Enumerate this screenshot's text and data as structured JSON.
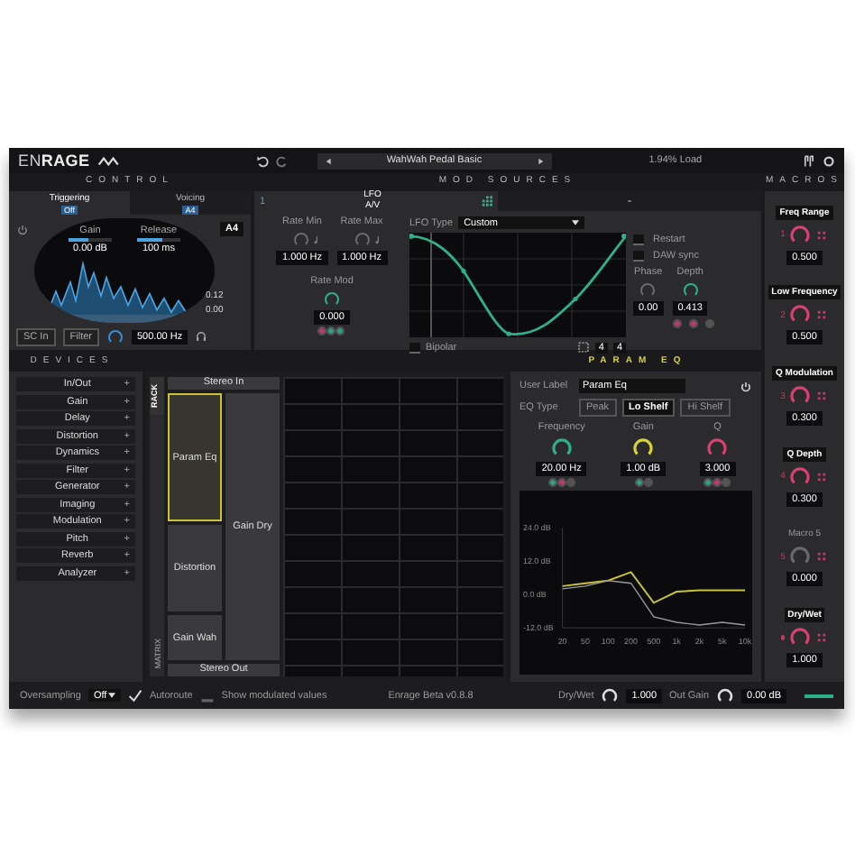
{
  "logo": {
    "part_1": "EN",
    "part_2": "RAGE"
  },
  "preset": {
    "name": "WahWah Pedal Basic"
  },
  "load": "1.94% Load",
  "headings": {
    "control": "CONTROL",
    "mod_sources": "MOD SOURCES",
    "macros": "MACROS",
    "devices": "DEVICES",
    "device": "PARAM EQ"
  },
  "control": {
    "tabs": [
      {
        "label": "Triggering",
        "value": "Off",
        "selected": true
      },
      {
        "label": "Voicing",
        "value": "A4",
        "selected": false
      }
    ],
    "gain": {
      "label": "Gain",
      "value": "0.00 dB",
      "level": 0.45
    },
    "release": {
      "label": "Release",
      "value": "100 ms",
      "level": 0.6
    },
    "note": "A4",
    "threshold_high": "0.12",
    "threshold_low": "0.00",
    "buttons": [
      "SC In",
      "Filter"
    ],
    "filter_freq": "500.00 Hz"
  },
  "mod": {
    "tabs": [
      {
        "number": "1",
        "label": "LFO",
        "sub": "A/V",
        "selected": true
      },
      {
        "selected": false
      }
    ],
    "knobs": [
      {
        "label": "Rate Min",
        "value": "1.000 Hz",
        "synced": true
      },
      {
        "label": "Rate Max",
        "value": "1.000 Hz",
        "synced": true
      },
      {
        "label": "Rate Mod",
        "value": "0.000",
        "dots": [
          {
            "color": "#c23a6a"
          },
          {
            "color": "#2fa37f"
          },
          {
            "color": "#2fa37f"
          }
        ]
      }
    ],
    "lfo_type_label": "LFO Type",
    "lfo_type": "Custom",
    "options": [
      {
        "label": "Restart",
        "checked": false
      },
      {
        "label": "DAW sync",
        "checked": false
      }
    ],
    "side_knobs": [
      {
        "label": "Phase",
        "value": "0.00"
      },
      {
        "label": "Depth",
        "value": "0.413",
        "dots": [
          {
            "color": "#c23a6a"
          },
          {
            "color": "#c23a6a"
          },
          {
            "color": "#555555"
          }
        ]
      }
    ],
    "bipolar": {
      "label": "Bipolar",
      "checked": false
    },
    "grid": [
      "4",
      "4"
    ]
  },
  "macros": [
    {
      "number": "1",
      "label": "Freq Range",
      "assigned": true,
      "value": "0.500"
    },
    {
      "number": "2",
      "label": "Low Frequency",
      "assigned": true,
      "value": "0.500"
    },
    {
      "number": "3",
      "label": "Q Modulation",
      "assigned": true,
      "value": "0.300"
    },
    {
      "number": "4",
      "label": "Q Depth",
      "assigned": true,
      "value": "0.300"
    },
    {
      "number": "5",
      "label": "Macro 5",
      "assigned": false,
      "value": "0.000"
    },
    {
      "label": "Dry/Wet",
      "assigned": true,
      "value": "1.000"
    }
  ],
  "devices": [
    {
      "label": "In/Out",
      "icon": "+"
    },
    {
      "label": "Gain",
      "icon": "+"
    },
    {
      "label": "Delay",
      "icon": "+"
    },
    {
      "label": "Distortion",
      "icon": "+"
    },
    {
      "label": "Dynamics",
      "icon": "+"
    },
    {
      "label": "Filter",
      "icon": "+"
    },
    {
      "label": "Generator",
      "icon": "+"
    },
    {
      "label": "Imaging",
      "icon": "+"
    },
    {
      "label": "Modulation",
      "icon": "+"
    },
    {
      "label": "Pitch",
      "icon": "+"
    },
    {
      "label": "Reverb",
      "icon": "+"
    },
    {
      "label": "Analyzer",
      "icon": "+"
    }
  ],
  "rack": {
    "tab_rack": "RACK",
    "tab_matrix": "MATRIX",
    "input": "Stereo In",
    "output": "Stereo Out",
    "nodes": [
      {
        "label": "Param Eq",
        "selected": true
      },
      {
        "label": "Distortion",
        "selected": false
      },
      {
        "label": "Gain Wah",
        "selected": false
      },
      {
        "label": "Gain Dry",
        "selected": false
      }
    ]
  },
  "eq": {
    "user_label": "User Label",
    "name": "Param Eq",
    "type_label": "EQ Type",
    "types": [
      {
        "label": "Peak",
        "selected": false
      },
      {
        "label": "Lo Shelf",
        "selected": true
      },
      {
        "label": "Hi Shelf",
        "selected": false
      }
    ],
    "knobs": [
      {
        "label": "Frequency",
        "value": "20.00 Hz",
        "dots": [
          {
            "color": "#2fa37f"
          },
          {
            "color": "#c23a6a"
          },
          {
            "color": "#555555"
          }
        ]
      },
      {
        "label": "Gain",
        "value": "1.00 dB",
        "dots": [
          {
            "color": "#2fa37f"
          },
          {
            "color": "#555555"
          }
        ]
      },
      {
        "label": "Q",
        "value": "3.000",
        "dots": [
          {
            "color": "#2fa37f"
          },
          {
            "color": "#c23a6a"
          },
          {
            "color": "#555555"
          }
        ]
      }
    ],
    "chart_data": {
      "type": "line",
      "categories": [
        "20",
        "50",
        "100",
        "200",
        "500",
        "1k",
        "2k",
        "5k",
        "10k"
      ],
      "yticks": [
        {
          "value": 24,
          "label": "24.0 dB"
        },
        {
          "value": 12,
          "label": "12.0 dB"
        },
        {
          "value": 0,
          "label": "0.0 dB"
        },
        {
          "value": -12,
          "label": "-12.0 dB"
        }
      ],
      "ylim": [
        -12,
        24
      ],
      "series": [
        {
          "color": "#c9c23a",
          "values": [
            3,
            4,
            5,
            8,
            -3,
            1,
            1.5,
            1.5,
            1.5
          ]
        },
        {
          "color": "#999999",
          "values": [
            2,
            3,
            5,
            4,
            -8,
            -10,
            -11,
            -10,
            -11
          ]
        }
      ]
    }
  },
  "footer": {
    "oversampling": "Oversampling",
    "oversampling_value": "Off",
    "autoroute": {
      "label": "Autoroute",
      "checked": true
    },
    "show_modulated": {
      "label": "Show modulated values",
      "checked": false
    },
    "version": "Enrage Beta v0.8.8",
    "dry_wet": {
      "label": "Dry/Wet",
      "value": "1.000"
    },
    "out_gain": {
      "label": "Out Gain",
      "value": "0.00 dB"
    }
  }
}
